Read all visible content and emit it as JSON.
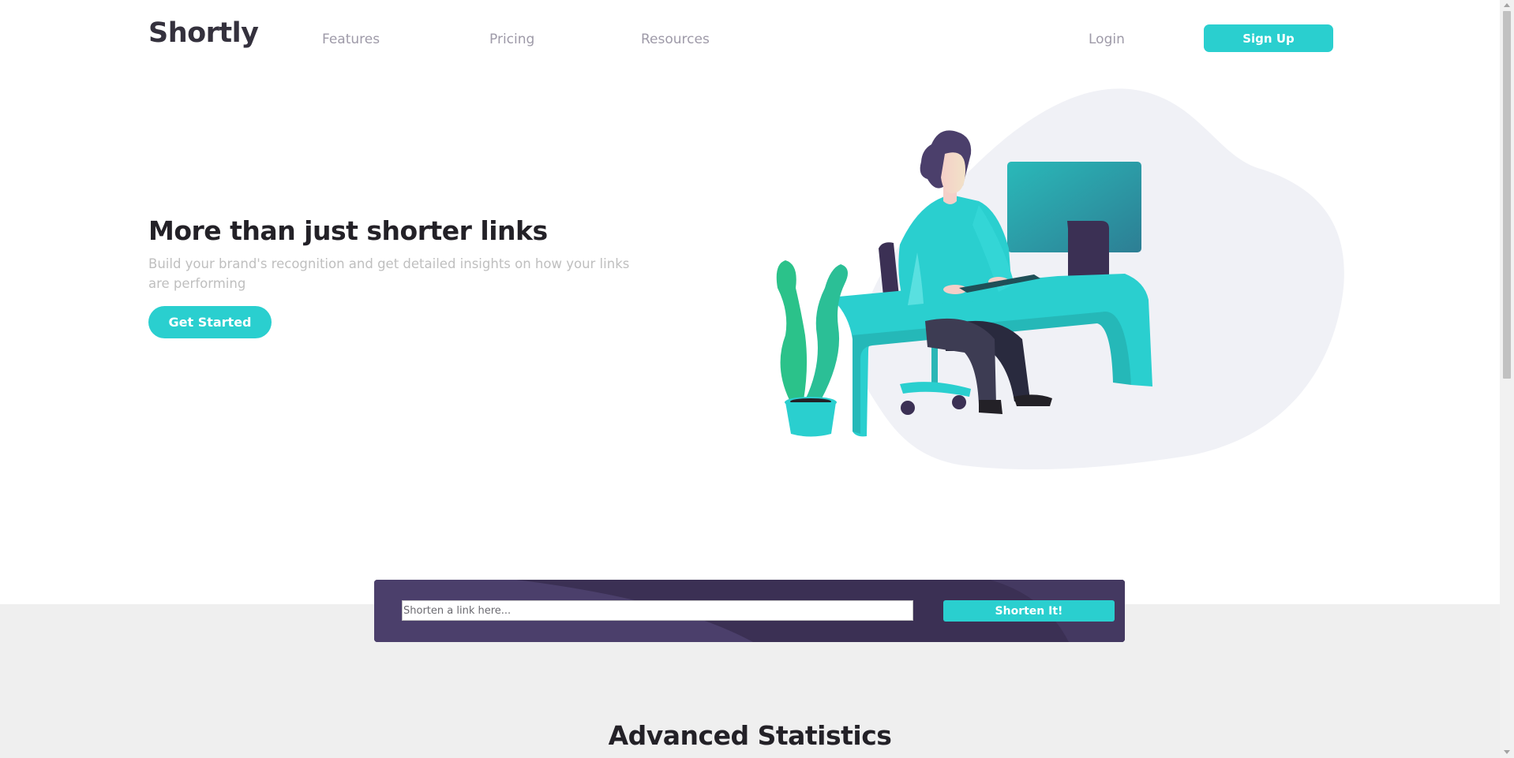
{
  "header": {
    "logo": "Shortly",
    "nav": {
      "features": "Features",
      "pricing": "Pricing",
      "resources": "Resources"
    },
    "login": "Login",
    "signup": "Sign Up"
  },
  "hero": {
    "title": "More than just shorter links",
    "subtitle": "Build your brand's recognition and get detailed insights on how your links are performing",
    "cta": "Get Started",
    "illustration": "person-working-at-desk-illustration"
  },
  "shorten": {
    "placeholder": "Shorten a link here...",
    "button": "Shorten It!"
  },
  "statistics": {
    "title": "Advanced Statistics"
  },
  "colors": {
    "primary": "#2acfcf",
    "dark_violet": "#3b3054",
    "grey_violet": "#9e9aa8",
    "very_dark_blue": "#34313d",
    "background_grey": "#efefef"
  }
}
